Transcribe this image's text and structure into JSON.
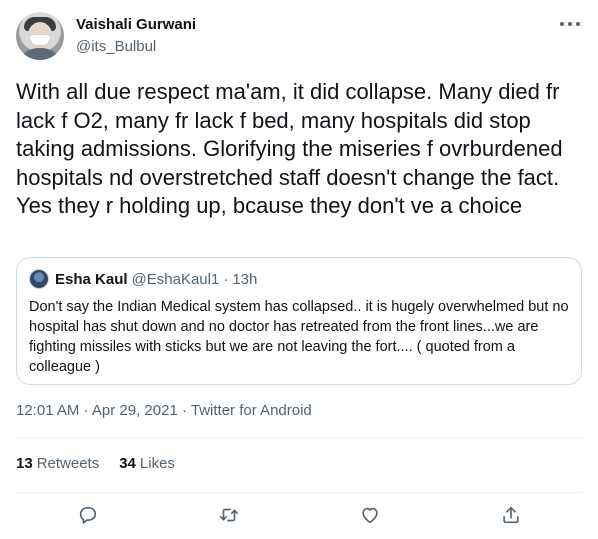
{
  "author": {
    "name": "Vaishali Gurwani",
    "handle": "@its_Bulbul"
  },
  "tweet": {
    "text": "With all due respect ma'am, it did collapse. Many died fr lack f O2, many fr lack f bed, many hospitals did stop taking admissions. Glorifying the miseries f ovrburdened hospitals nd overstretched staff doesn't change the fact. Yes they r holding up, bcause they don't ve a choice"
  },
  "quote": {
    "name": "Esha Kaul",
    "handle": "@EshaKaul1",
    "separator": "·",
    "time": "13h",
    "text": "Don't say the Indian Medical system has collapsed.. it is hugely overwhelmed but no hospital has shut down and no doctor has retreated from the front lines...we are fighting missiles with sticks  but we are not leaving the fort.... ( quoted from a colleague )"
  },
  "meta": {
    "time": "12:01 AM",
    "separator": " · ",
    "date": "Apr 29, 2021",
    "source": "Twitter for Android"
  },
  "stats": {
    "retweets_count": "13",
    "retweets_label": "Retweets",
    "likes_count": "34",
    "likes_label": "Likes"
  },
  "actions": [
    {
      "icon": "reply-icon"
    },
    {
      "icon": "retweet-icon"
    },
    {
      "icon": "like-icon"
    },
    {
      "icon": "share-icon"
    }
  ],
  "colors": {
    "text": "#0f1419",
    "secondary": "#536471",
    "border": "#cfd9de"
  }
}
